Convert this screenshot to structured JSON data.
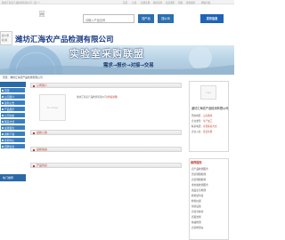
{
  "topbar": {
    "left_text": "潍坊汇海农产品检测有限公司（第一）",
    "links": [
      "首页",
      "订阅",
      "免费注册",
      "我的商务",
      "会员服务",
      "帮助",
      "搜索推荐",
      "网站导航"
    ]
  },
  "search": {
    "placeholder": "请输入产品名称",
    "btn_product": "搜产品",
    "btn_company": "搜公司",
    "btn_publish": "发布信息"
  },
  "login": {
    "line1": "商人登",
    "line2": "机 阅"
  },
  "company": {
    "name": "潍坊汇海农产品检测有限公司"
  },
  "banner": {
    "title": "实验室采购联盟",
    "subtitle": "需求→报价→对接→交易"
  },
  "breadcrumb": "首页：潍坊汇海农产品检测有限公司",
  "sidebar": {
    "items": [
      "首页",
      "公司简介",
      "最新公告",
      "产品展示",
      "公司动态",
      "联系方式",
      "在线留言",
      "资料下载",
      "新闻中心",
      "招聘信息"
    ],
    "footer": "热门推荐"
  },
  "main": {
    "panel_company": "公司简介",
    "no_image": "No Image",
    "blurb": "潍坊汇海农产品检测有限公司",
    "blurb_link": "[查看详细]",
    "panel_desc": "最新公告",
    "panel_news": "最新动态",
    "panel_products": "产品列表"
  },
  "right": {
    "logo_text": "Logo",
    "name": "潍坊汇海农产品检测有限公司",
    "location_label": "所在地区：",
    "location_value": "山东潍坊",
    "type_label": "企业类型：",
    "type_value": "生产加工",
    "phone_label": "联系电话：",
    "phone_value": "详见联系方式",
    "join": "企业入驻：",
    "join_value": "会员免费",
    "recommend_head": "推荐服务",
    "recommend_items": [
      "农产品检测服务",
      "兽药残留检测",
      "农药残留检测",
      "重金属检测服务",
      "食品安全检测",
      "检测试剂盒",
      "检测仪器",
      "化验设备",
      "实验室耗材",
      "质量监督",
      "快速检测",
      "农药检测仪"
    ]
  },
  "colors": {
    "accent": "#2c6fb0",
    "sidebar": "#3b7fc0",
    "highlight": "#c0392b"
  }
}
